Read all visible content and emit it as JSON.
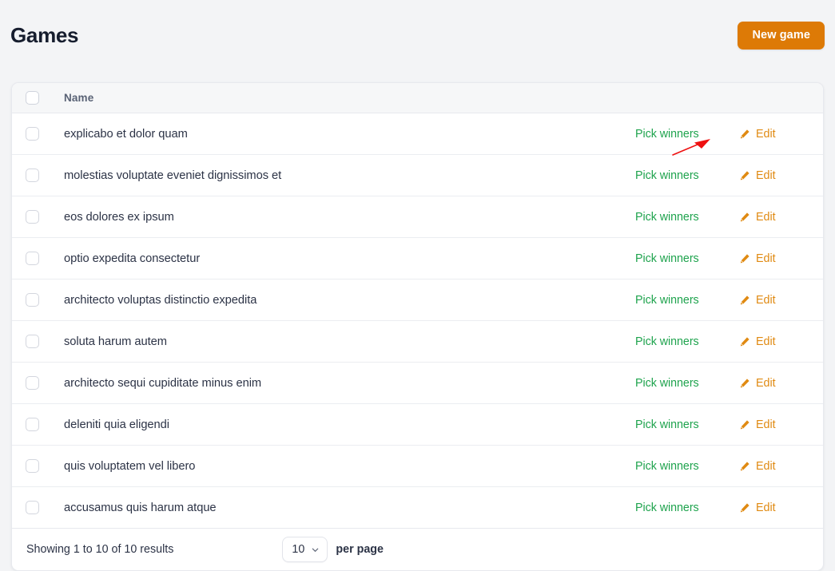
{
  "header": {
    "title": "Games",
    "new_game_label": "New game"
  },
  "colors": {
    "brand_orange": "#dd7a06",
    "edit_orange": "#e08a12",
    "pick_green": "#1ea34d",
    "title_navy": "#161d2e",
    "annotation_red": "#ee1111",
    "page_bg": "#f3f4f6",
    "header_row_bg": "#f6f7f8"
  },
  "table": {
    "columns": {
      "select_all": "select-all-checkbox",
      "name": "Name"
    },
    "row_actions": {
      "pick_winners_label": "Pick winners",
      "edit_label": "Edit",
      "edit_icon": "pencil-icon"
    },
    "rows": [
      {
        "name": "explicabo et dolor quam"
      },
      {
        "name": "molestias voluptate eveniet dignissimos et"
      },
      {
        "name": "eos dolores ex ipsum"
      },
      {
        "name": "optio expedita consectetur"
      },
      {
        "name": "architecto voluptas distinctio expedita"
      },
      {
        "name": "soluta harum autem"
      },
      {
        "name": "architecto sequi cupiditate minus enim"
      },
      {
        "name": "deleniti quia eligendi"
      },
      {
        "name": "quis voluptatem vel libero"
      },
      {
        "name": "accusamus quis harum atque"
      }
    ]
  },
  "footer": {
    "results_text": "Showing 1 to 10 of 10 results",
    "per_page_value": "10",
    "per_page_label": "per page",
    "per_page_options": [
      "10"
    ],
    "chevron_icon": "chevron-down-icon"
  },
  "annotation": {
    "type": "arrow",
    "icon": "red-arrow-annotation",
    "points_to": "Pick winners"
  }
}
